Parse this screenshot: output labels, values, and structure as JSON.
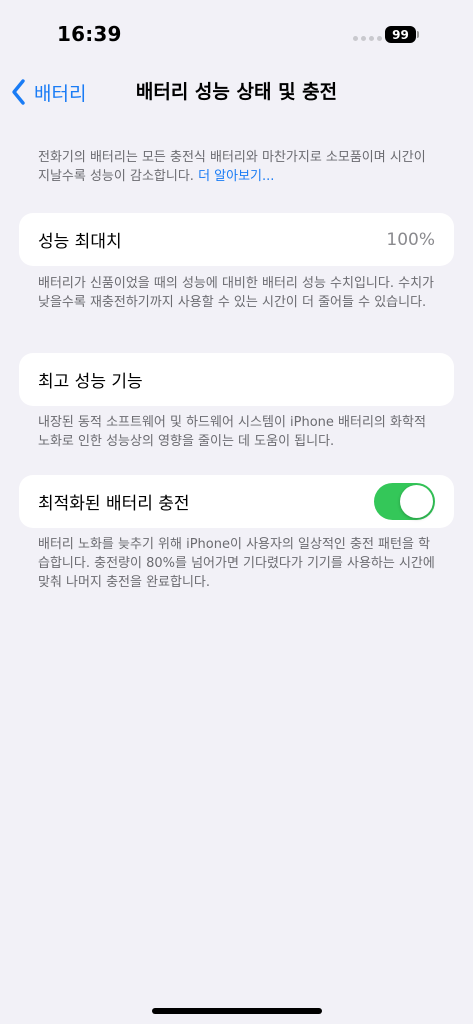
{
  "status_bar": {
    "time": "16:39",
    "battery_level": "99"
  },
  "nav": {
    "back_label": "배터리",
    "title": "배터리 성능 상태 및 충전"
  },
  "intro": {
    "text": "전화기의 배터리는 모든 충전식 배터리와 마찬가지로 소모품이며 시간이 지날수록 성능이 감소합니다. ",
    "link": "더 알아보기..."
  },
  "max_capacity": {
    "label": "성능 최대치",
    "value": "100%",
    "note": "배터리가 신품이었을 때의 성능에 대비한 배터리 성능 수치입니다. 수치가 낮을수록 재충전하기까지 사용할 수 있는 시간이 더 줄어들 수 있습니다."
  },
  "peak_performance": {
    "label": "최고 성능 기능",
    "note": "내장된 동적 소프트웨어 및 하드웨어 시스템이 iPhone 배터리의 화학적 노화로 인한 성능상의 영향을 줄이는 데 도움이 됩니다."
  },
  "optimized_charging": {
    "label": "최적화된 배터리 충전",
    "enabled": true,
    "note": "배터리 노화를 늦추기 위해 iPhone이 사용자의 일상적인 충전 패턴을 학습합니다. 충전량이 80%를 넘어가면 기다렸다가 기기를 사용하는 시간에 맞춰 나머지 충전을 완료합니다."
  },
  "colors": {
    "accent": "#1a7cf5",
    "toggle_on": "#34c759",
    "background": "#f2f1f7"
  }
}
